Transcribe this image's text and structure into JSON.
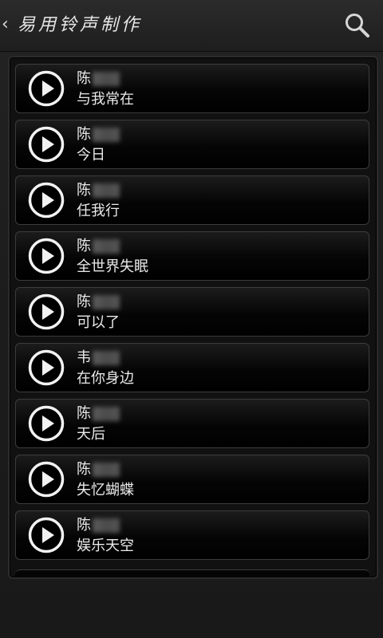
{
  "header": {
    "back_glyph": "‹",
    "title": "易用铃声制作",
    "search_icon": "search-icon"
  },
  "songs": [
    {
      "artist": "陈",
      "title": "与我常在"
    },
    {
      "artist": "陈",
      "title": "今日"
    },
    {
      "artist": "陈",
      "title": "任我行"
    },
    {
      "artist": "陈",
      "title": "全世界失眠"
    },
    {
      "artist": "陈",
      "title": "可以了"
    },
    {
      "artist": "韦",
      "title": "在你身边"
    },
    {
      "artist": "陈",
      "title": "天后"
    },
    {
      "artist": "陈",
      "title": "失忆蝴蝶"
    },
    {
      "artist": "陈",
      "title": "娱乐天空"
    }
  ],
  "colors": {
    "text": "#eaeaea",
    "row_border": "#3c3c3c"
  }
}
